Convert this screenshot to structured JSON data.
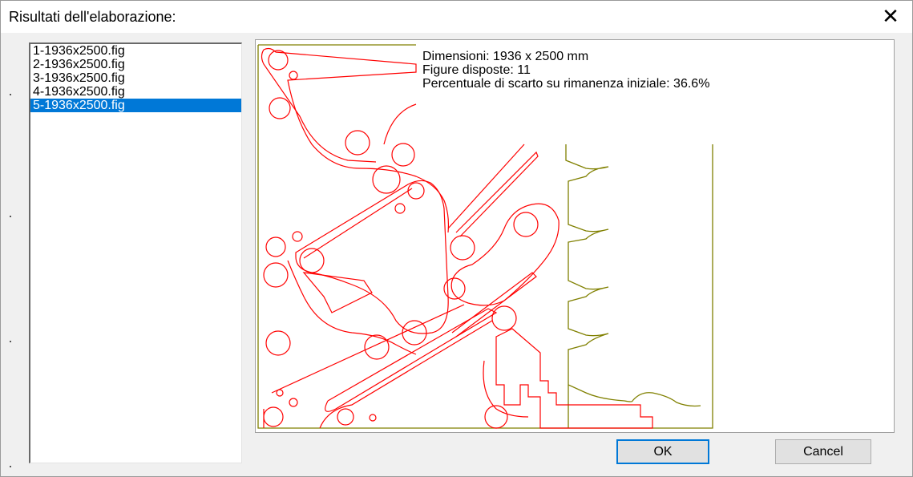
{
  "dialog": {
    "title": "Risultati dell'elaborazione:",
    "close_icon": "close-icon"
  },
  "results": {
    "items": [
      {
        "label": "1-1936x2500.fig"
      },
      {
        "label": "2-1936x2500.fig"
      },
      {
        "label": "3-1936x2500.fig"
      },
      {
        "label": "4-1936x2500.fig"
      },
      {
        "label": "5-1936x2500.fig"
      }
    ],
    "selected_index": 4
  },
  "preview": {
    "dimensions": "Dimensioni: 1936 x 2500 mm",
    "figures": "Figure disposte: 11",
    "waste": "Percentuale di scarto su rimanenza iniziale: 36.6%",
    "sheet_color": "#808000",
    "parts_color": "#ff0000"
  },
  "buttons": {
    "ok": "OK",
    "cancel": "Cancel"
  }
}
